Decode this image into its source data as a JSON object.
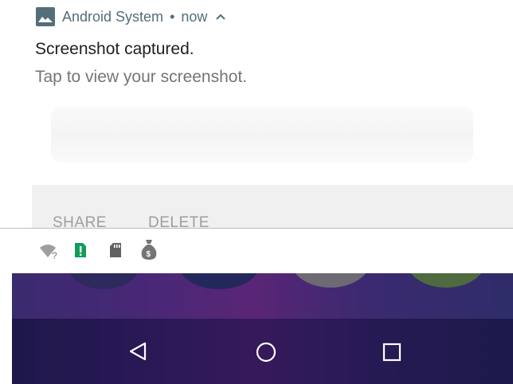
{
  "notification": {
    "app_name": "Android System",
    "separator": "•",
    "time": "now",
    "title": "Screenshot captured.",
    "text": "Tap to view your screenshot.",
    "app_icon": "image-icon",
    "expand_icon": "chevron-up-icon",
    "actions": [
      "SHARE",
      "DELETE"
    ]
  },
  "status_icons": [
    "wifi-unknown-icon",
    "sim-alert-icon",
    "sd-card-icon",
    "money-bag-icon"
  ],
  "nav_bar": {
    "buttons": [
      "back-icon",
      "home-icon",
      "recents-icon"
    ]
  },
  "colors": {
    "header_text": "#546e7a",
    "accent_green": "#0f9d58",
    "action_text": "#9e9e9e",
    "wallpaper": "#3a2a6e"
  }
}
